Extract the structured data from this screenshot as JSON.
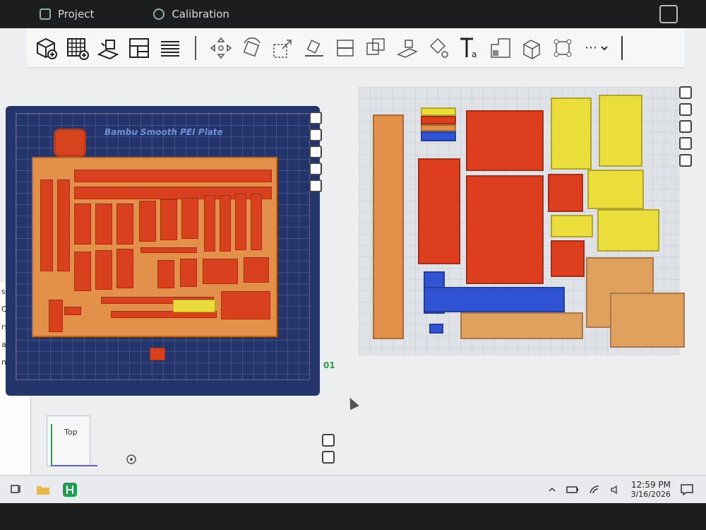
{
  "tabs": {
    "project": "Project",
    "calibration": "Calibration"
  },
  "toolbar": {
    "more_label": "⋯",
    "icons": [
      "add-cube-icon",
      "grid-add-icon",
      "import-icon",
      "layout-icon",
      "layers-icon",
      "move-icon",
      "rotate-icon",
      "scale-icon",
      "lay-flat-icon",
      "cut-icon",
      "boolean-icon",
      "support-paint-icon",
      "color-paint-icon",
      "text-icon",
      "emboss-icon",
      "measure-icon",
      "assembly-icon",
      "split-icon"
    ]
  },
  "plate1": {
    "name": "Bambu Smooth PEI Plate",
    "number": "01"
  },
  "view": {
    "orientation_label": "Top"
  },
  "sidebar": {
    "items": [
      "s",
      "Q",
      "rs",
      "am",
      "mm"
    ]
  },
  "taskbar": {
    "time": "12:59 PM",
    "date": "3/16/2026"
  },
  "colors": {
    "plate_blue": "#24356b",
    "tray_orange": "#e3904a",
    "filament_red": "#dd3f1e",
    "filament_yellow": "#ebde3a",
    "filament_blue": "#2f53d2",
    "status_green": "#2ea04f"
  }
}
